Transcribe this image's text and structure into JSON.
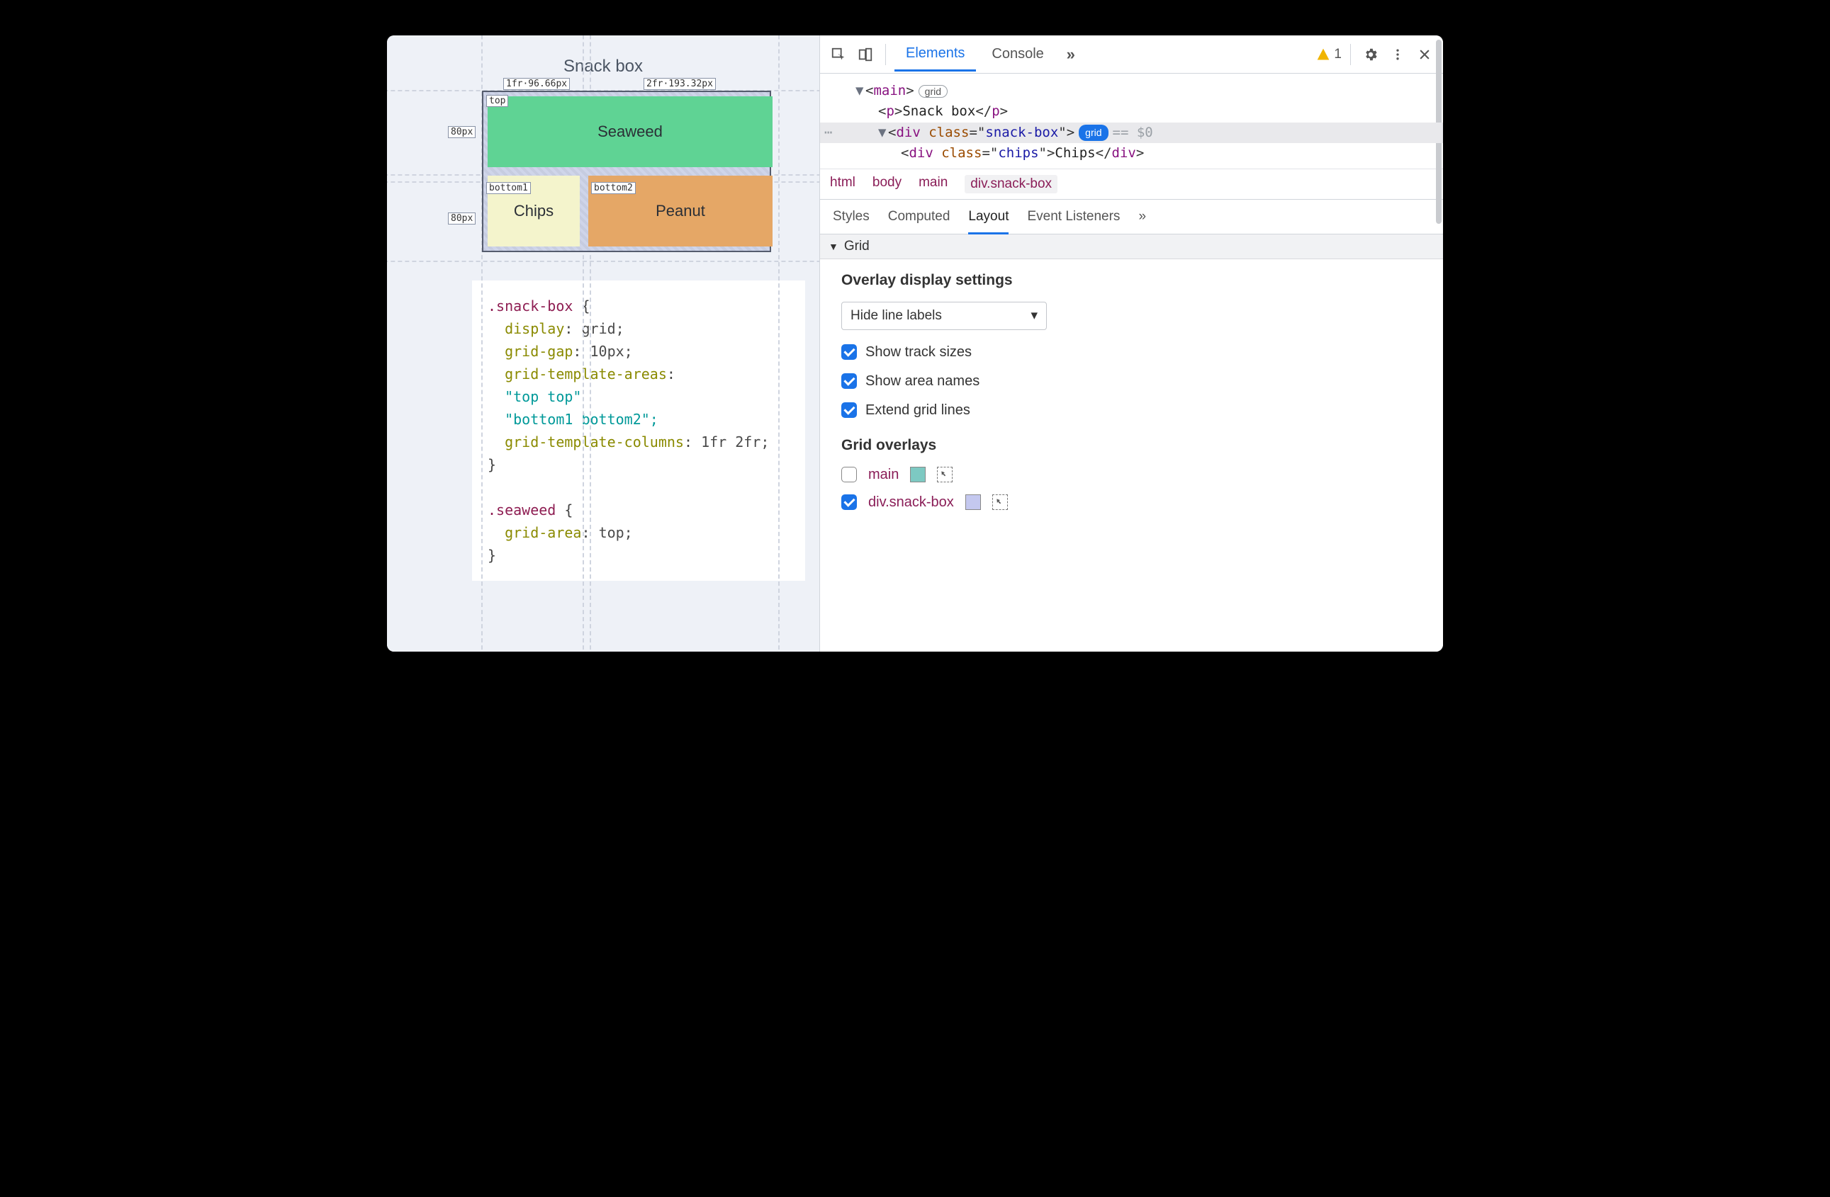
{
  "preview": {
    "title": "Snack box",
    "col_labels": [
      "1fr·96.66px",
      "2fr·193.32px"
    ],
    "row_labels": [
      "80px",
      "80px"
    ],
    "area_labels": [
      "top",
      "bottom1",
      "bottom2"
    ],
    "cells": {
      "seaweed": "Seaweed",
      "chips": "Chips",
      "peanut": "Peanut"
    }
  },
  "code": {
    "lines": [
      {
        "t": "sel",
        "v": ".snack-box {"
      },
      {
        "t": "decl",
        "p": "display",
        "v": "grid;"
      },
      {
        "t": "decl",
        "p": "grid-gap",
        "v": "10px;"
      },
      {
        "t": "decl",
        "p": "grid-template-areas",
        "v": ":"
      },
      {
        "t": "str",
        "v": "\"top top\""
      },
      {
        "t": "str",
        "v": "\"bottom1 bottom2\";"
      },
      {
        "t": "decl",
        "p": "grid-template-columns",
        "v": "1fr 2fr;"
      },
      {
        "t": "plain",
        "v": "}"
      },
      {
        "t": "blank",
        "v": ""
      },
      {
        "t": "sel",
        "v": ".seaweed {"
      },
      {
        "t": "decl",
        "p": "grid-area",
        "v": "top;"
      },
      {
        "t": "plain",
        "v": "}"
      }
    ]
  },
  "topbar": {
    "tabs": [
      "Elements",
      "Console"
    ],
    "warn_count": "1"
  },
  "dom": {
    "l1_tag": "main",
    "l1_badge": "grid",
    "l2_tag": "p",
    "l2_text": "Snack box",
    "l3_tag": "div",
    "l3_attr_name": "class",
    "l3_attr_val": "snack-box",
    "l3_badge": "grid",
    "l3_suffix": "== $0",
    "l4_tag": "div",
    "l4_attr_name": "class",
    "l4_attr_val": "chips",
    "l4_text": "Chips"
  },
  "breadcrumb": [
    "html",
    "body",
    "main",
    "div.snack-box"
  ],
  "panel_tabs": [
    "Styles",
    "Computed",
    "Layout",
    "Event Listeners"
  ],
  "layout": {
    "section": "Grid",
    "settings_head": "Overlay display settings",
    "dropdown": "Hide line labels",
    "checks": [
      {
        "label": "Show track sizes",
        "checked": true
      },
      {
        "label": "Show area names",
        "checked": true
      },
      {
        "label": "Extend grid lines",
        "checked": true
      }
    ],
    "overlays_head": "Grid overlays",
    "overlays": [
      {
        "label": "main",
        "checked": false,
        "swatch": "sw-teal"
      },
      {
        "label": "div.snack-box",
        "checked": true,
        "swatch": "sw-lilac"
      }
    ]
  }
}
